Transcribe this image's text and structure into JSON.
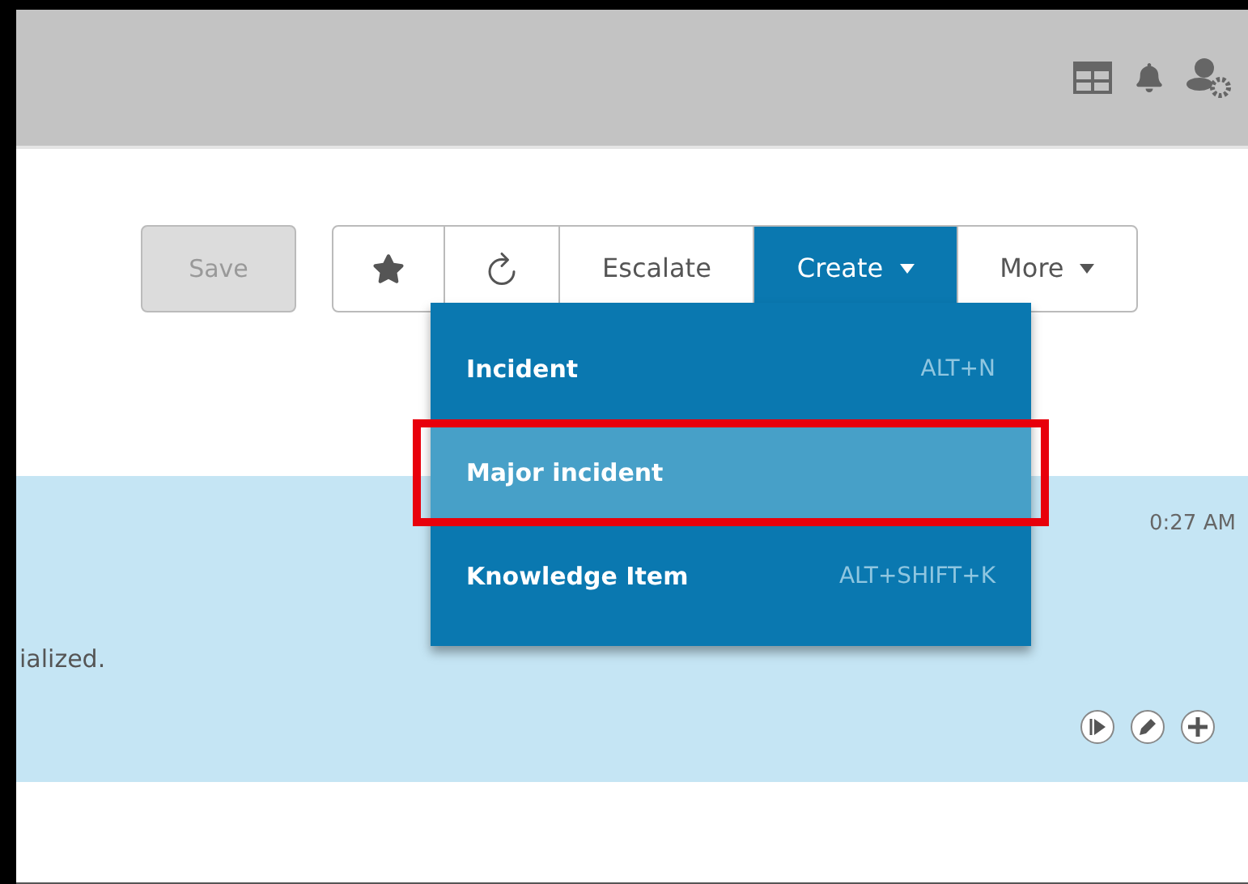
{
  "toolbar": {
    "save": {
      "label": "Save",
      "disabled": true
    },
    "buttons": [
      {
        "kind": "star"
      },
      {
        "kind": "refresh"
      },
      {
        "kind": "text",
        "label": "Escalate",
        "open": false
      },
      {
        "kind": "menu",
        "label": "Create",
        "open": true
      },
      {
        "kind": "menu",
        "label": "More",
        "open": false
      }
    ]
  },
  "create_menu": {
    "items": [
      {
        "label": "Incident",
        "shortcut": "ALT+N",
        "selected": false,
        "highlighted": false
      },
      {
        "label": "Major incident",
        "selected": true,
        "highlighted": true
      },
      {
        "label": "Knowledge Item",
        "shortcut": "ALT+SHIFT+K",
        "selected": false,
        "highlighted": false
      }
    ]
  },
  "entry": {
    "time": "0:27 AM",
    "text": "ialized."
  }
}
